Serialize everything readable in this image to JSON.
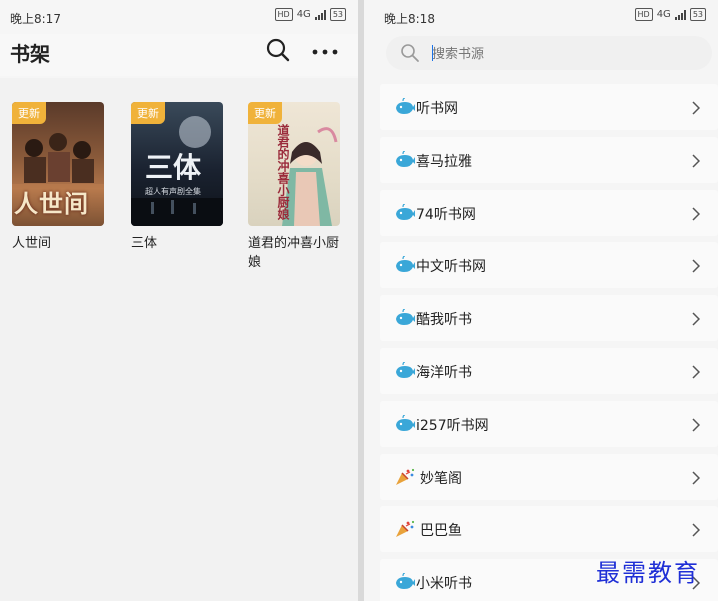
{
  "left_screen": {
    "status": {
      "time": "晚上8:17",
      "net": "4G",
      "battery": "53"
    },
    "title": "书架",
    "books": [
      {
        "title": "人世间",
        "badge": "更新",
        "cover_text": "人世间"
      },
      {
        "title": "三体",
        "badge": "更新",
        "cover_text": "三体",
        "cover_subtitle": "超人有声剧全集"
      },
      {
        "title": "道君的冲喜小厨娘",
        "badge": "更新",
        "cover_text": "道君的冲喜小厨娘"
      }
    ]
  },
  "right_screen": {
    "status": {
      "time": "晚上8:18",
      "net": "4G",
      "battery": "53"
    },
    "search": {
      "placeholder": "搜索书源",
      "value": ""
    },
    "sources": [
      {
        "label": "听书网",
        "icon": "whale-icon"
      },
      {
        "label": "喜马拉雅",
        "icon": "whale-icon"
      },
      {
        "label": "74听书网",
        "icon": "whale-icon"
      },
      {
        "label": "中文听书网",
        "icon": "whale-icon"
      },
      {
        "label": "酷我听书",
        "icon": "whale-icon"
      },
      {
        "label": "海洋听书",
        "icon": "whale-icon"
      },
      {
        "label": "i257听书网",
        "icon": "whale-icon"
      },
      {
        "label": "妙笔阁",
        "icon": "party-popper-icon"
      },
      {
        "label": "巴巴鱼",
        "icon": "party-popper-icon"
      },
      {
        "label": "小米听书",
        "icon": "whale-icon"
      }
    ]
  },
  "watermark": "最需教育",
  "colors": {
    "badge": "#f0b23a",
    "accent": "#1a73e8",
    "whale": "#3aa7d8",
    "watermark": "#1f2fd6"
  }
}
